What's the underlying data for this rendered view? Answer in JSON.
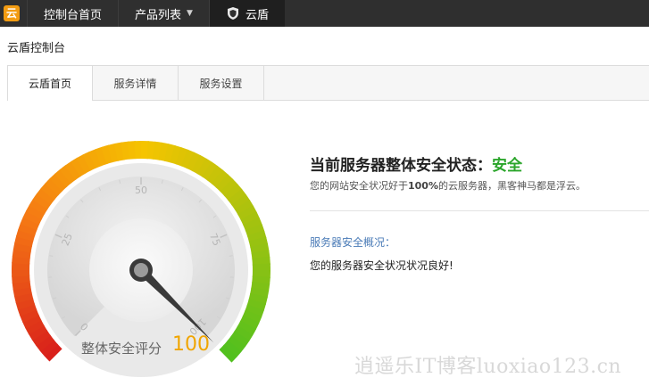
{
  "topbar": {
    "logo_text": "云",
    "items": [
      {
        "label": "控制台首页"
      },
      {
        "label": "产品列表"
      },
      {
        "label": "云盾"
      }
    ]
  },
  "console_title": "云盾控制台",
  "tabs": [
    {
      "label": "云盾首页",
      "active": true
    },
    {
      "label": "服务详情",
      "active": false
    },
    {
      "label": "服务设置",
      "active": false
    }
  ],
  "gauge": {
    "ticks": [
      "0",
      "25",
      "50",
      "75",
      "100"
    ],
    "score_label": "整体安全评分",
    "score": 100,
    "min": 0,
    "max": 100,
    "colors": {
      "low": "#d9201b",
      "mid": "#f5c400",
      "high": "#4ec01f"
    }
  },
  "status": {
    "title_prefix": "当前服务器整体安全状态：",
    "title_state": "安全",
    "desc_prefix": "您的网站安全状况好于",
    "desc_bold": "100%",
    "desc_suffix": "的云服务器，黑客神马都是浮云。"
  },
  "overview": {
    "label": "服务器安全概况：",
    "text": "您的服务器安全状况状况良好!"
  },
  "watermark": "逍遥乐IT博客luoxiao123.cn"
}
